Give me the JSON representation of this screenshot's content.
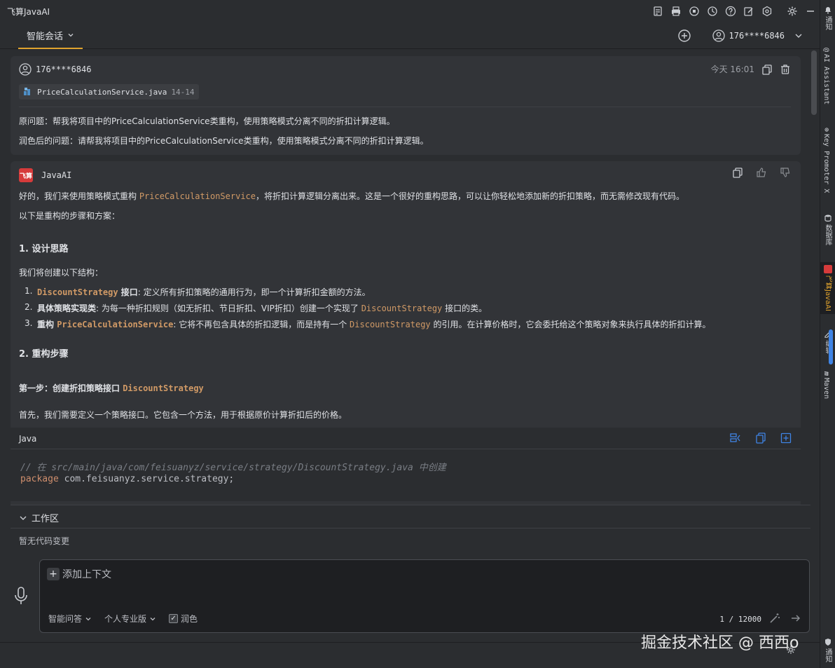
{
  "window": {
    "title": "飞算JavaAI"
  },
  "tabs": {
    "active_label": "智能会话"
  },
  "header": {
    "user": "176****6846"
  },
  "right_strip": {
    "items": [
      "通知",
      "AI Assistant",
      "Key Promoter X",
      "数据库",
      "飞算JavaAI",
      "编辑",
      "Maven",
      "通知"
    ]
  },
  "question": {
    "user": "176****6846",
    "time": "今天  16:01",
    "file_name": "PriceCalculationService.java",
    "file_lines": "14-14",
    "original": "原问题：帮我将项目中的PriceCalculationService类重构，使用策略模式分离不同的折扣计算逻辑。",
    "polished": "润色后的问题：请帮我将项目中的PriceCalculationService类重构，使用策略模式分离不同的折扣计算逻辑。"
  },
  "answer": {
    "logo": "飞算",
    "bot": "JavaAI",
    "p1_a": "好的，我们来使用策略模式重构 ",
    "p1_code": "PriceCalculationService",
    "p1_b": "，将折扣计算逻辑分离出来。这是一个很好的重构思路，可以让你轻松地添加新的折扣策略，而无需修改现有代码。",
    "p2": "以下是重构的步骤和方案：",
    "h1": "1. 设计思路",
    "p3": "我们将创建以下结构：",
    "list": [
      {
        "num": "1.",
        "code": "DiscountStrategy",
        "bold": " 接口",
        "text": ": 定义所有折扣策略的通用行为，即一个计算折扣金额的方法。",
        "code2": "",
        "text2": ""
      },
      {
        "num": "2.",
        "code": "",
        "bold": "具体策略实现类",
        "text": ": 为每一种折扣规则（如无折扣、节日折扣、VIP折扣）创建一个实现了 ",
        "code2": "DiscountStrategy",
        "text2": " 接口的类。"
      },
      {
        "num": "3.",
        "code": "PriceCalculationService",
        "bold": "重构 ",
        "text": ": 它将不再包含具体的折扣逻辑，而是持有一个 ",
        "code2": "DiscountStrategy",
        "text2": " 的引用。在计算价格时，它会委托给这个策略对象来执行具体的折扣计算。"
      }
    ],
    "h2": "2. 重构步骤",
    "step1_a": "第一步：创建折扣策略接口 ",
    "step1_code": "DiscountStrategy",
    "p4": "首先，我们需要定义一个策略接口。它包含一个方法，用于根据原价计算折扣后的价格。"
  },
  "code_block": {
    "lang": "Java",
    "comment": "// 在 src/main/java/com/feisuanyz/service/strategy/DiscountStrategy.java 中创建",
    "kw": "package",
    "pkg": " com.feisuanyz.service.strategy;"
  },
  "workspace": {
    "title": "工作区",
    "empty": "暂无代码变更"
  },
  "input": {
    "add_context": "添加上下文",
    "mode": "智能问答",
    "plan": "个人专业版",
    "polish": "润色",
    "counter": "1 / 12000"
  },
  "watermark": "掘金技术社区 @ 西西o",
  "colors": {
    "accent": "#e0a32e",
    "code_inline": "#d19a66",
    "link_blue": "#3f84e5",
    "brand_red": "#d63b3b"
  }
}
